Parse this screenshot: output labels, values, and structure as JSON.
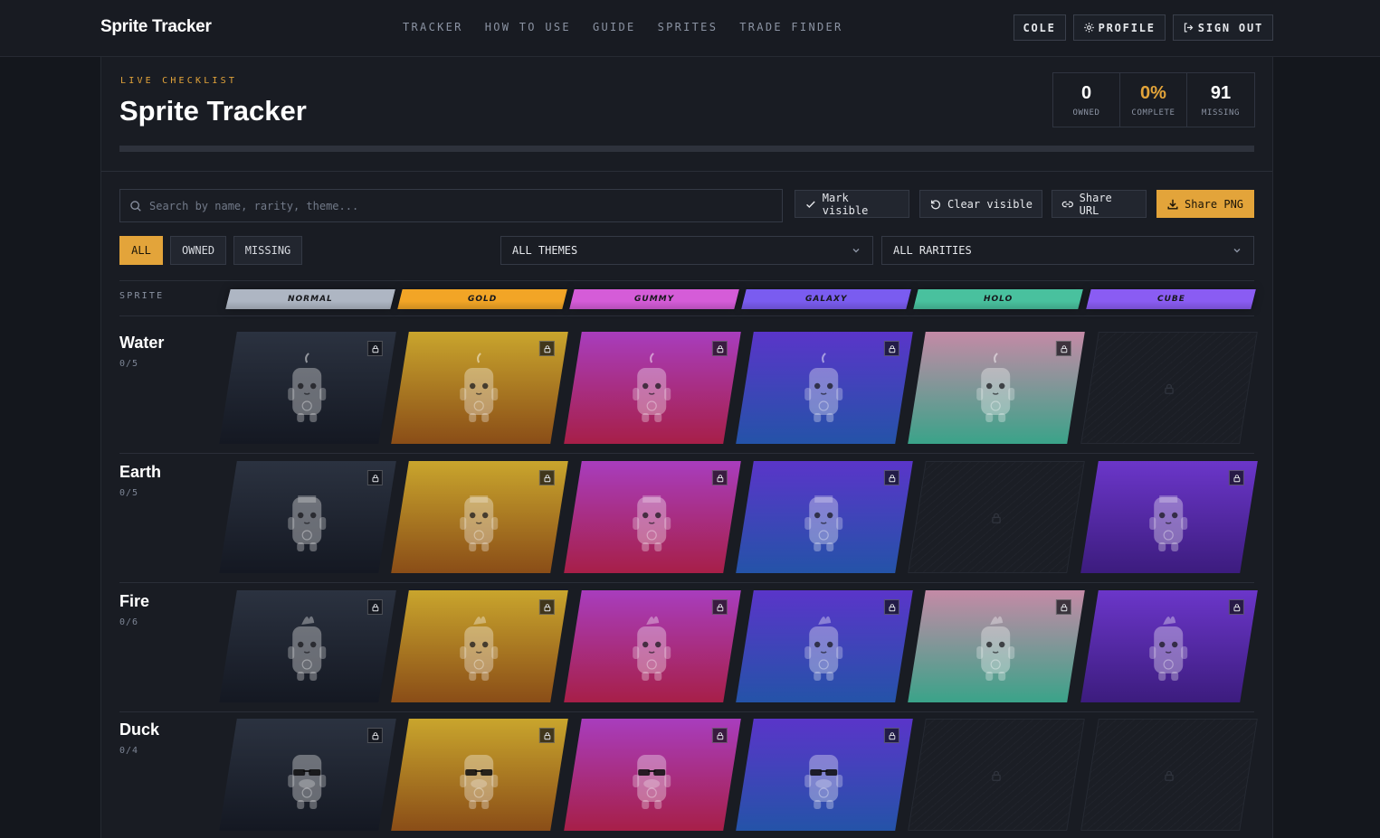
{
  "brand": "Sprite Tracker",
  "nav": [
    "TRACKER",
    "HOW TO USE",
    "GUIDE",
    "SPRITES",
    "TRADE FINDER"
  ],
  "top_actions": {
    "user": "COLE",
    "profile": "PROFILE",
    "signout": "SIGN OUT"
  },
  "hero": {
    "eyebrow": "LIVE CHECKLIST",
    "title": "Sprite Tracker",
    "stats": [
      {
        "value": "0",
        "label": "OWNED"
      },
      {
        "value": "0%",
        "label": "COMPLETE"
      },
      {
        "value": "91",
        "label": "MISSING"
      }
    ],
    "progress_fraction": 0
  },
  "search": {
    "placeholder": "Search by name, rarity, theme..."
  },
  "actions": {
    "mark": "Mark visible",
    "clear": "Clear visible",
    "share_url": "Share URL",
    "share_png": "Share PNG"
  },
  "filters": {
    "all": "ALL",
    "owned": "OWNED",
    "missing": "MISSING",
    "active": "ALL"
  },
  "theme_select": "ALL THEMES",
  "rarity_select": "ALL RARITIES",
  "table": {
    "sprite_header": "SPRITE",
    "rarities": [
      {
        "name": "NORMAL",
        "color": "#aeb6c3"
      },
      {
        "name": "GOLD",
        "color": "#f2a526"
      },
      {
        "name": "GUMMY",
        "color": "#d55cd8"
      },
      {
        "name": "GALAXY",
        "color": "#7a5cf0"
      },
      {
        "name": "HOLO",
        "color": "#49c19e"
      },
      {
        "name": "CUBE",
        "color": "#8a5cf3"
      }
    ]
  },
  "sprites": [
    {
      "name": "Water",
      "count": "0/5",
      "variants": [
        "normal",
        "gold",
        "gummy",
        "galaxy",
        "holo",
        null
      ],
      "icon": "water-sprite-icon"
    },
    {
      "name": "Earth",
      "count": "0/5",
      "variants": [
        "normal",
        "gold",
        "gummy",
        "galaxy",
        null,
        "cube"
      ],
      "icon": "earth-sprite-icon"
    },
    {
      "name": "Fire",
      "count": "0/6",
      "variants": [
        "normal",
        "gold",
        "gummy",
        "galaxy",
        "holo",
        "cube"
      ],
      "icon": "fire-sprite-icon"
    },
    {
      "name": "Duck",
      "count": "0/4",
      "variants": [
        "normal",
        "gold",
        "gummy",
        "galaxy",
        null,
        null
      ],
      "icon": "duck-sprite-icon"
    }
  ]
}
